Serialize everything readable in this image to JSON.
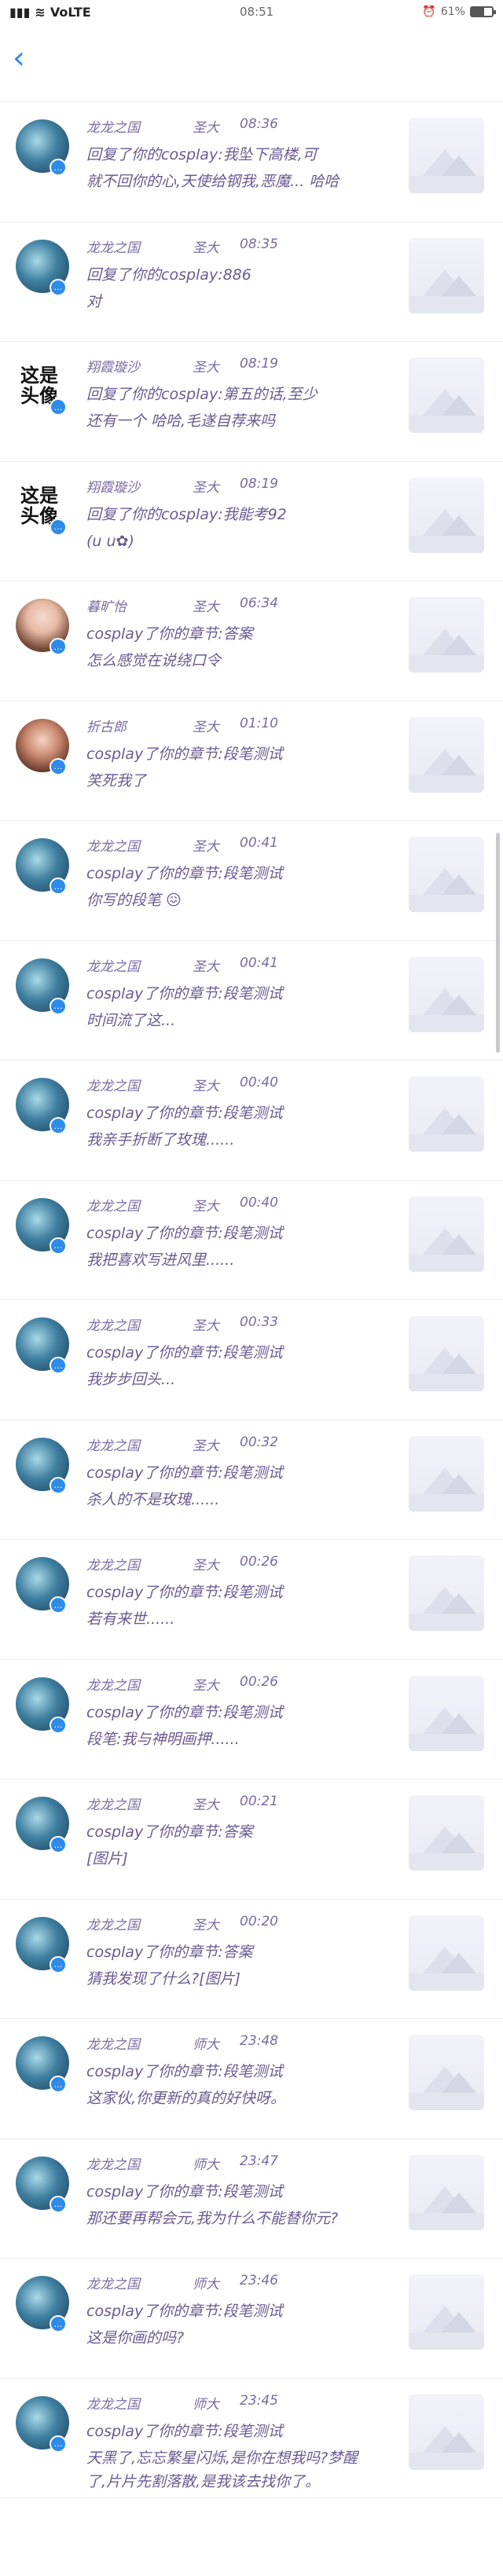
{
  "status": {
    "signal": "‍.ıl",
    "network": "VoLTE",
    "time": "08:51",
    "battery": "61%",
    "battery_level": 0.61
  },
  "nav": {
    "back_icon": "chevron-left-icon"
  },
  "items": [
    {
      "avatar": "game",
      "name": "龙龙之国",
      "role": "圣大",
      "time": "08:36",
      "line1": "回复了你的cosplay:我坠下高楼,可",
      "line2": "就不回你的心,天使给钢我,恶魔... 哈哈"
    },
    {
      "avatar": "game",
      "name": "龙龙之国",
      "role": "圣大",
      "time": "08:35",
      "line1": "回复了你的cosplay:886",
      "line2": "对"
    },
    {
      "avatar": "text",
      "avatar_text": "这是\n头像",
      "name": "翔霞璇沙",
      "role": "圣大",
      "time": "08:19",
      "line1": "回复了你的cosplay:第五的话,至少",
      "line2": "还有一个 哈哈,毛遂自荐来吗"
    },
    {
      "avatar": "text",
      "avatar_text": "这是\n头像",
      "name": "翔霞璇沙",
      "role": "圣大",
      "time": "08:19",
      "line1": "回复了你的cosplay:我能考92",
      "line2": "(u u✿)"
    },
    {
      "avatar": "portrait1",
      "name": "暮旷怡",
      "role": "圣大",
      "time": "06:34",
      "line1": "cosplay了你的章节:答案",
      "line2": "怎么感觉在说绕口令"
    },
    {
      "avatar": "portrait2",
      "name": "折古郎",
      "role": "圣大",
      "time": "01:10",
      "line1": "cosplay了你的章节:段笔测试",
      "line2": "笑死我了"
    },
    {
      "avatar": "game",
      "name": "龙龙之国",
      "role": "圣大",
      "time": "00:41",
      "line1": "cosplay了你的章节:段笔测试",
      "line2": "你写的段笔 😖"
    },
    {
      "avatar": "game",
      "name": "龙龙之国",
      "role": "圣大",
      "time": "00:41",
      "line1": "cosplay了你的章节:段笔测试",
      "line2": "时间流了这..."
    },
    {
      "avatar": "game",
      "name": "龙龙之国",
      "role": "圣大",
      "time": "00:40",
      "line1": "cosplay了你的章节:段笔测试",
      "line2": "我亲手折断了玫瑰......"
    },
    {
      "avatar": "game",
      "name": "龙龙之国",
      "role": "圣大",
      "time": "00:40",
      "line1": "cosplay了你的章节:段笔测试",
      "line2": "我把喜欢写进风里......"
    },
    {
      "avatar": "game",
      "name": "龙龙之国",
      "role": "圣大",
      "time": "00:33",
      "line1": "cosplay了你的章节:段笔测试",
      "line2": "我步步回头..."
    },
    {
      "avatar": "game",
      "name": "龙龙之国",
      "role": "圣大",
      "time": "00:32",
      "line1": "cosplay了你的章节:段笔测试",
      "line2": "杀人的不是玫瑰......"
    },
    {
      "avatar": "game",
      "name": "龙龙之国",
      "role": "圣大",
      "time": "00:26",
      "line1": "cosplay了你的章节:段笔测试",
      "line2": "若有来世......"
    },
    {
      "avatar": "game",
      "name": "龙龙之国",
      "role": "圣大",
      "time": "00:26",
      "line1": "cosplay了你的章节:段笔测试",
      "line2": "段笔:我与神明画押......"
    },
    {
      "avatar": "game",
      "name": "龙龙之国",
      "role": "圣大",
      "time": "00:21",
      "line1": "cosplay了你的章节:答案",
      "line2": "[图片]"
    },
    {
      "avatar": "game",
      "name": "龙龙之国",
      "role": "圣大",
      "time": "00:20",
      "line1": "cosplay了你的章节:答案",
      "line2": "猜我发现了什么?[图片]"
    },
    {
      "avatar": "game",
      "name": "龙龙之国",
      "role": "师大",
      "time": "23:48",
      "line1": "cosplay了你的章节:段笔测试",
      "line2": "这家伙,你更新的真的好快呀。"
    },
    {
      "avatar": "game",
      "name": "龙龙之国",
      "role": "师大",
      "time": "23:47",
      "line1": "cosplay了你的章节:段笔测试",
      "line2": "那还要再帮会元,我为什么不能替你元?"
    },
    {
      "avatar": "game",
      "name": "龙龙之国",
      "role": "师大",
      "time": "23:46",
      "line1": "cosplay了你的章节:段笔测试",
      "line2": "这是你画的吗?"
    },
    {
      "avatar": "game",
      "name": "龙龙之国",
      "role": "师大",
      "time": "23:45",
      "line1": "cosplay了你的章节:段笔测试",
      "line2": "天黑了,忘忘繁星闪烁,是你在想我吗?梦醒了,片片先割落散,是我该去找你了。"
    }
  ]
}
